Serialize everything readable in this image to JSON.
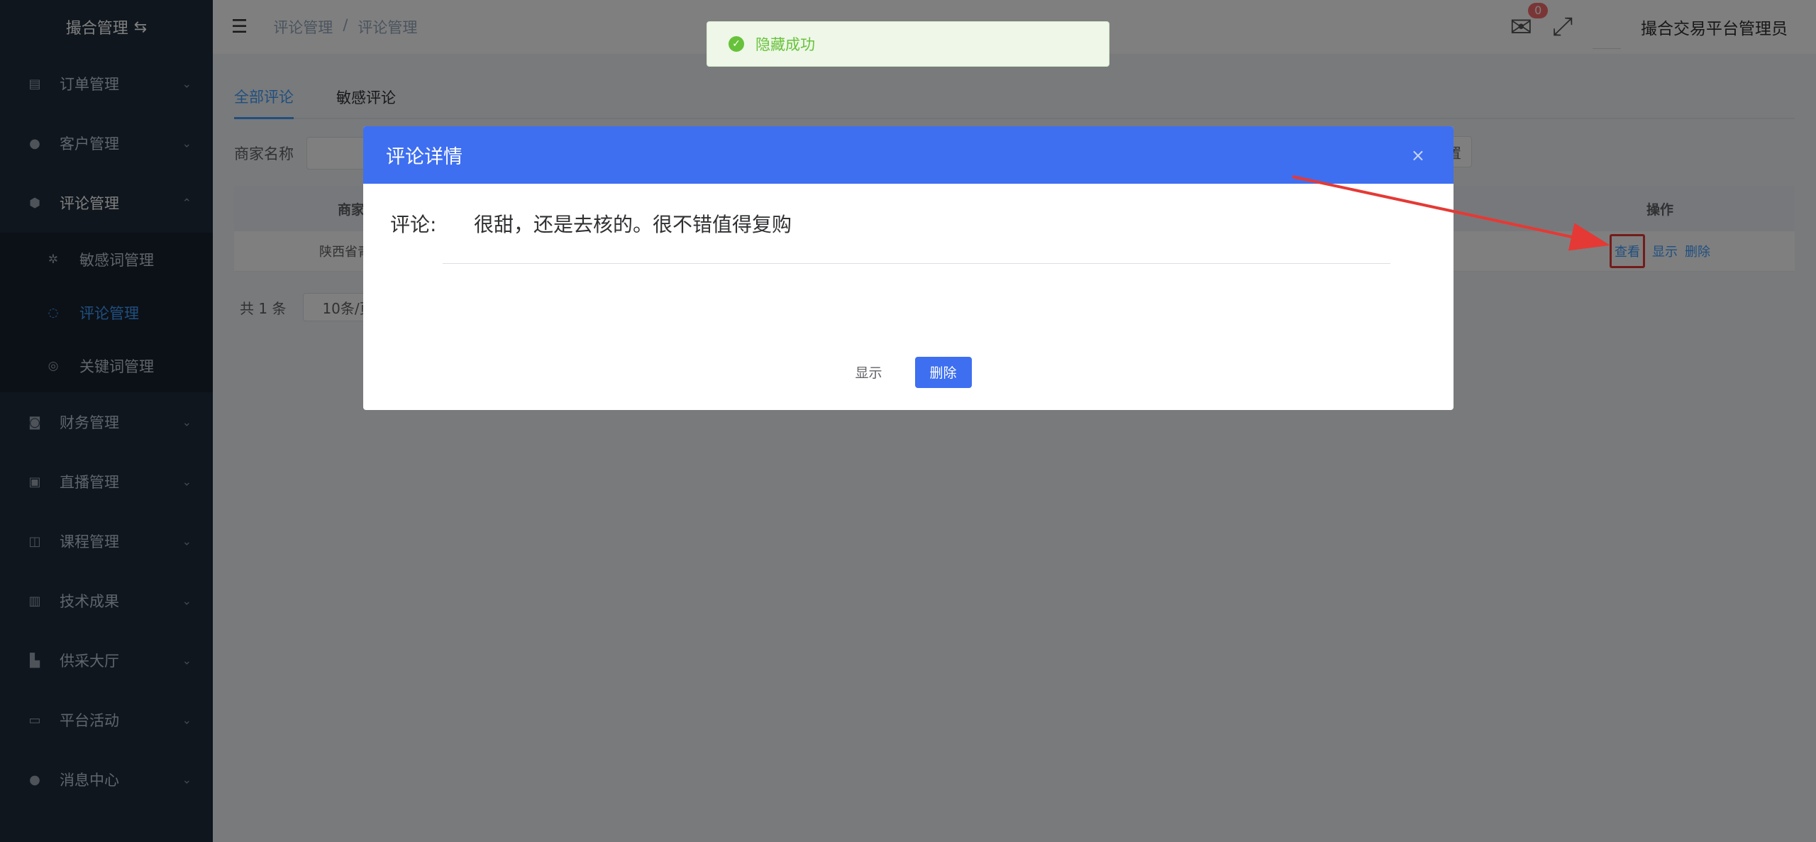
{
  "sidebar": {
    "brand": "撮合管理",
    "menu": [
      {
        "label": "订单管理",
        "icon": "document-icon"
      },
      {
        "label": "客户管理",
        "icon": "user-icon"
      },
      {
        "label": "评论管理",
        "icon": "shield-icon",
        "expanded": true
      },
      {
        "label": "财务管理",
        "icon": "wallet-icon"
      },
      {
        "label": "直播管理",
        "icon": "video-icon"
      },
      {
        "label": "课程管理",
        "icon": "book-icon"
      },
      {
        "label": "技术成果",
        "icon": "list-icon"
      },
      {
        "label": "供采大厅",
        "icon": "building-icon"
      },
      {
        "label": "平台活动",
        "icon": "monitor-icon"
      },
      {
        "label": "消息中心",
        "icon": "chat-icon"
      }
    ],
    "submenu": [
      {
        "label": "敏感词管理",
        "icon": "sparkle-icon"
      },
      {
        "label": "评论管理",
        "icon": "comment-icon",
        "active": true
      },
      {
        "label": "关键词管理",
        "icon": "target-icon"
      }
    ]
  },
  "navbar": {
    "breadcrumb": [
      "评论管理",
      "/",
      "评论管理"
    ],
    "mail_count": "0",
    "username": "撮合交易平台管理员"
  },
  "tabs": [
    {
      "label": "全部评论",
      "active": true
    },
    {
      "label": "敏感评论",
      "active": false
    }
  ],
  "filter": {
    "merchant_label": "商家名称",
    "reset_label": "置"
  },
  "table": {
    "headers": {
      "merchant": "商家",
      "op": "操作"
    },
    "rows": [
      {
        "merchant": "陕西省青年",
        "mid": "46",
        "view": "查看",
        "show": "显示",
        "delete": "删除"
      }
    ]
  },
  "pager": {
    "total": "共 1 条",
    "size": "10条/页"
  },
  "toast": {
    "text": "隐藏成功"
  },
  "dialog": {
    "title": "评论详情",
    "close": "×",
    "comment_label": "评论:",
    "comment_text": "很甜，还是去核的。很不错值得复购",
    "show_label": "显示",
    "delete_label": "删除"
  },
  "colors": {
    "primary": "#3e6ff1",
    "sidebar": "#1f2d3d",
    "annotation": "#e53935"
  }
}
